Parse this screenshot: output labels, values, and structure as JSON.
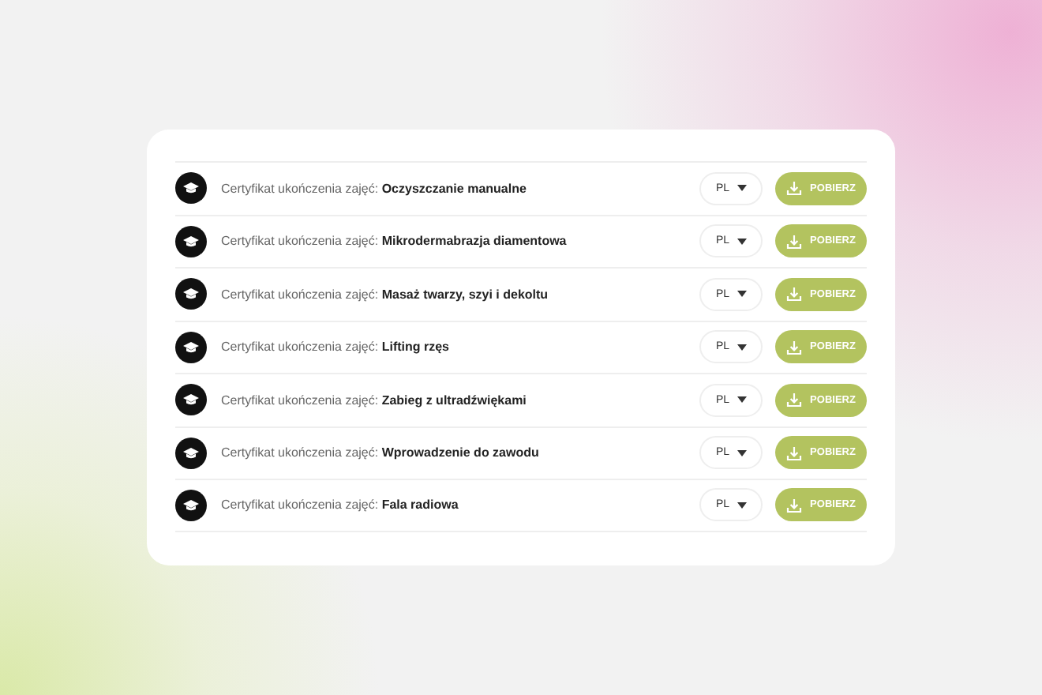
{
  "certificates": [
    {
      "title": "Certyfikat ukończenia zajęć: **Oczyszczanie manualne**",
      "language": "PL",
      "button": "POBIERZ"
    },
    {
      "title": "Certyfikat ukończenia zajęć: **Mikrodermabrazja diamentowa**",
      "language": "PL",
      "button": "POBIERZ"
    },
    {
      "title": "Certyfikat ukończenia zajęć: **Masaż twarzy, szyi i dekoltu**",
      "language": "PL",
      "button": "POBIERZ"
    },
    {
      "title": "Certyfikat ukończenia zajęć: **Lifting rzęs**",
      "language": "PL",
      "button": "POBIERZ"
    },
    {
      "title": "Certyfikat ukończenia zajęć: **Zabieg z ultradźwiękami**",
      "language": "PL",
      "button": "POBIERZ"
    },
    {
      "title": "Certyfikat ukończenia zajęć: **Wprowadzenie do zawodu**",
      "language": "PL",
      "button": "POBIERZ"
    },
    {
      "title": "Certyfikat ukończenia zajęć: **Fala radiowa**",
      "language": "PL",
      "button": "POBIERZ"
    }
  ]
}
